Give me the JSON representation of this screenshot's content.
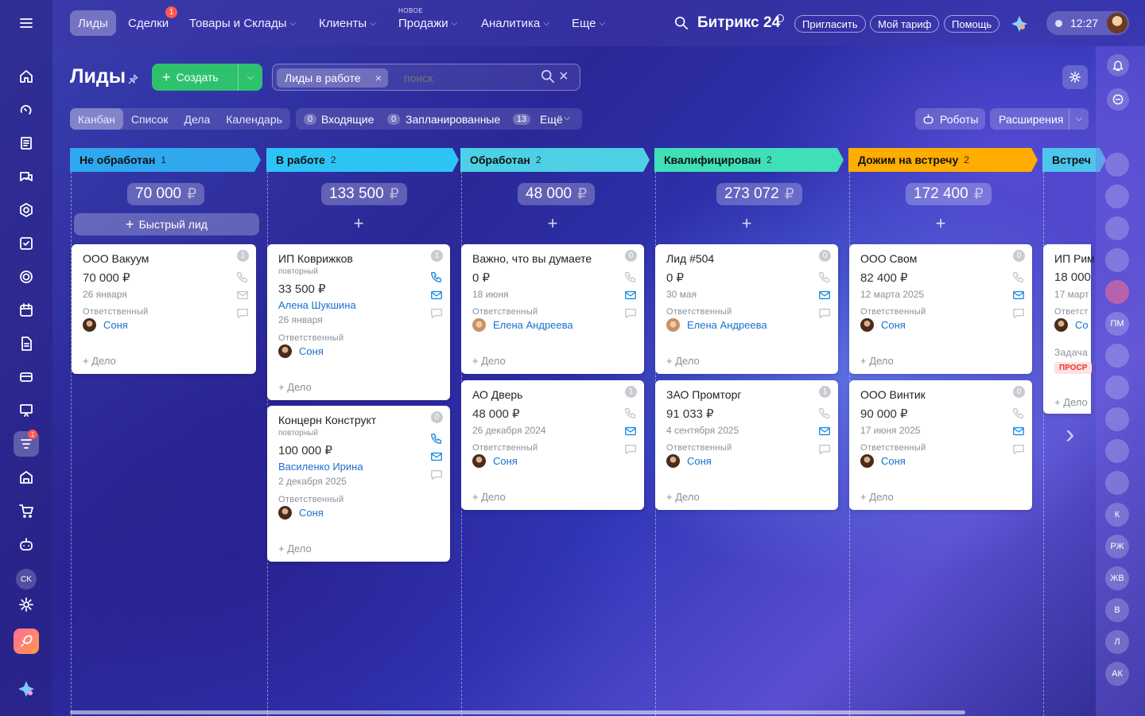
{
  "topbar": {
    "menu_icon": "hamburger-icon",
    "nav": [
      {
        "label": "Лиды",
        "active": true
      },
      {
        "label": "Сделки",
        "badge": "1"
      },
      {
        "label": "Товары и Склады",
        "dropdown": true
      },
      {
        "label": "Клиенты",
        "dropdown": true
      },
      {
        "label": "Продажи",
        "dropdown": true,
        "overline": "НОВОЕ"
      },
      {
        "label": "Аналитика",
        "dropdown": true
      },
      {
        "label": "Еще",
        "dropdown": true
      }
    ],
    "brand": "Битрикс 24",
    "invite": "Пригласить",
    "tariff": "Мой тариф",
    "help": "Помощь",
    "time": "12:27"
  },
  "sidebar": {
    "icons": [
      "home-icon",
      "pulse-icon",
      "document-icon",
      "chat-icon",
      "ai-icon",
      "tasks-icon",
      "circle-icon",
      "calendar-icon",
      "file-icon",
      "card-icon",
      "presentation-icon",
      "crm-icon",
      "store-icon",
      "cart-icon",
      "bot-icon",
      "ck-icon",
      "settings-icon",
      "rocket-icon",
      "copilot-icon"
    ],
    "crm_badge": "1",
    "ck_label": "CK"
  },
  "header": {
    "title": "Лиды",
    "create_label": "Создать",
    "filter_tag": "Лиды в работе",
    "search_placeholder": "поиск"
  },
  "view_tabs": [
    "Канбан",
    "Список",
    "Дела",
    "Календарь"
  ],
  "counters": {
    "incoming_count": "0",
    "incoming_label": "Входящие",
    "planned_count": "0",
    "planned_label": "Запланированные",
    "more_count": "13",
    "more_label": "Ещё"
  },
  "toolbar": {
    "robots": "Роботы",
    "extensions": "Расширения"
  },
  "columns": [
    {
      "title": "Не обработан",
      "count": "1",
      "sum": "70 000",
      "currency": "₽",
      "color": "#2fa8f0"
    },
    {
      "title": "В работе",
      "count": "2",
      "sum": "133 500",
      "currency": "₽",
      "color": "#2ec3f5"
    },
    {
      "title": "Обработан",
      "count": "2",
      "sum": "48 000",
      "currency": "₽",
      "color": "#4dd0e6"
    },
    {
      "title": "Квалифицирован",
      "count": "2",
      "sum": "273 072",
      "currency": "₽",
      "color": "#3fe0b8"
    },
    {
      "title": "Дожим на встречу",
      "count": "2",
      "sum": "172 400",
      "currency": "₽",
      "color": "#ffad00"
    },
    {
      "title": "Встреч",
      "color": "#4dc6ee"
    }
  ],
  "quick_lead": "Быстрый лид",
  "cards": [
    {
      "title": "ООО Вакуум",
      "count": "1",
      "amount": "70 000 ₽",
      "date": "26 января",
      "resp_label": "Ответственный",
      "resp": "Соня",
      "add": "+ Дело"
    },
    {
      "title": "ИП Коврижков",
      "count": "1",
      "repeat": "повторный",
      "amount": "33 500 ₽",
      "contact": "Алена Шукшина",
      "date": "26 января",
      "resp_label": "Ответственный",
      "resp": "Соня",
      "add": "+ Дело"
    },
    {
      "title": "Концерн Конструкт",
      "count": "0",
      "repeat": "повторный",
      "amount": "100 000 ₽",
      "contact": "Василенко Ирина",
      "date": "2 декабря 2025",
      "resp_label": "Ответственный",
      "resp": "Соня",
      "add": "+ Дело"
    },
    {
      "title": "Важно, что вы думаете",
      "count": "0",
      "amount": "0 ₽",
      "date": "18 июня",
      "resp_label": "Ответственный",
      "resp": "Елена Андреева",
      "add": "+ Дело"
    },
    {
      "title": "АО Дверь",
      "count": "1",
      "amount": "48 000 ₽",
      "date": "26 декабря 2024",
      "resp_label": "Ответственный",
      "resp": "Соня",
      "add": "+ Дело"
    },
    {
      "title": "Лид #504",
      "count": "0",
      "amount": "0 ₽",
      "date": "30 мая",
      "resp_label": "Ответственный",
      "resp": "Елена Андреева",
      "add": "+ Дело"
    },
    {
      "title": "ЗАО Промторг",
      "count": "1",
      "amount": "91 033 ₽",
      "date": "4 сентября 2025",
      "resp_label": "Ответственный",
      "resp": "Соня",
      "add": "+ Дело"
    },
    {
      "title": "ООО Свом",
      "count": "0",
      "amount": "82 400 ₽",
      "date": "12 марта 2025",
      "resp_label": "Ответственный",
      "resp": "Соня",
      "add": "+ Дело"
    },
    {
      "title": "ООО Винтик",
      "count": "0",
      "amount": "90 000 ₽",
      "date": "17 июня 2025",
      "resp_label": "Ответственный",
      "resp": "Соня",
      "add": "+ Дело"
    },
    {
      "title": "ИП Рим",
      "amount": "18 000",
      "date": "17 март",
      "resp_label": "Ответст",
      "resp": "Со",
      "task": "Задача",
      "overdue": "ПРОСР",
      "add": "+ Дело"
    }
  ],
  "right_rail": [
    "ПМ",
    "К",
    "РЖ",
    "ЖВ",
    "В",
    "Л",
    "АК"
  ]
}
